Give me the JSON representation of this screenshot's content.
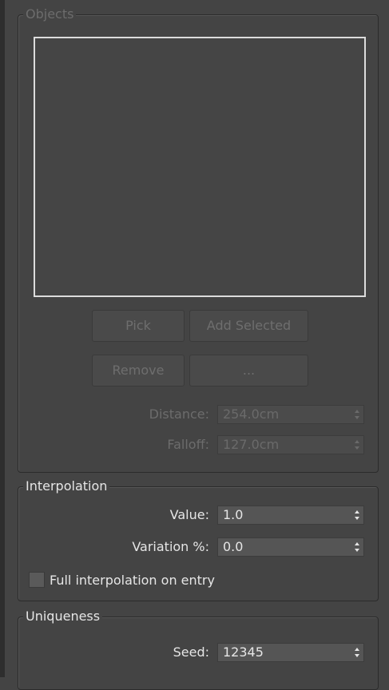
{
  "objects": {
    "title": "Objects",
    "buttons": {
      "pick": "Pick",
      "add_selected": "Add Selected",
      "remove": "Remove",
      "more": "..."
    },
    "distance": {
      "label": "Distance:",
      "value": "254.0cm"
    },
    "falloff": {
      "label": "Falloff:",
      "value": "127.0cm"
    }
  },
  "interpolation": {
    "title": "Interpolation",
    "value": {
      "label": "Value:",
      "value": "1.0"
    },
    "variation": {
      "label": "Variation %:",
      "value": "0.0"
    },
    "full_interp": {
      "label": "Full interpolation on entry",
      "checked": false
    }
  },
  "uniqueness": {
    "title": "Uniqueness",
    "seed": {
      "label": "Seed:",
      "value": "12345"
    }
  },
  "icons": {
    "spinner": "up-down-arrows-icon"
  },
  "colors": {
    "panel_bg": "#444444",
    "list_border": "#dcdcdc",
    "disabled_text": "#6c6c6c",
    "text": "#e6e6e6"
  }
}
